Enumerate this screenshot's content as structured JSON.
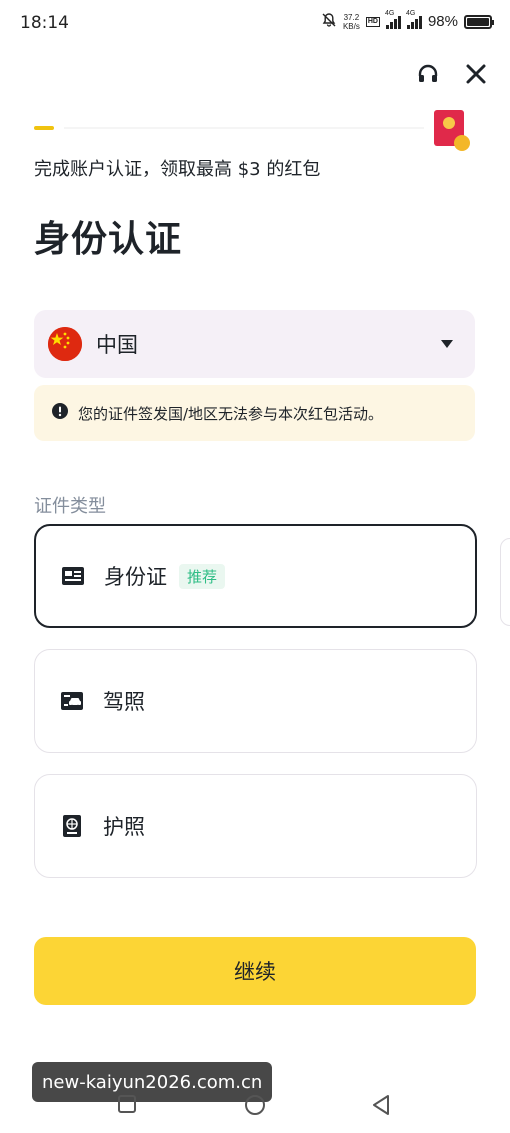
{
  "status_bar": {
    "time": "18:14",
    "net_speed_value": "37.2",
    "net_speed_unit": "KB/s",
    "hd_label": "HD",
    "signal_1_label": "4G",
    "signal_2_label": "4G",
    "battery_text": "98%",
    "battery_level": 0.98
  },
  "header": {
    "support_icon": "headset-icon",
    "close_icon": "close-icon",
    "reward_icon": "red-packet-icon"
  },
  "promo_text": "完成账户认证，领取最高 $3 的红包",
  "page_title": "身份认证",
  "country": {
    "flag_icon": "china-flag-icon",
    "name": "中国"
  },
  "notice": {
    "icon": "warning-icon",
    "text": "您的证件签发国/地区无法参与本次红包活动。"
  },
  "document_type_label": "证件类型",
  "documents": [
    {
      "icon": "id-card-icon",
      "label": "身份证",
      "badge": "推荐",
      "selected": true
    },
    {
      "icon": "driver-license-icon",
      "label": "驾照",
      "badge": "",
      "selected": false
    },
    {
      "icon": "passport-icon",
      "label": "护照",
      "badge": "",
      "selected": false
    }
  ],
  "continue_label": "继续",
  "nav_bar": {
    "recent_icon": "square-icon",
    "home_icon": "circle-icon",
    "back_icon": "triangle-back-icon"
  },
  "watermark": "new-kaiyun2026.com.cn",
  "colors": {
    "accent": "#fcd535",
    "text": "#1e2329",
    "muted": "#848e9c",
    "badge_green": "#2ebd85",
    "notice_bg": "#fdf6e3",
    "select_bg": "#f5f0f7"
  }
}
